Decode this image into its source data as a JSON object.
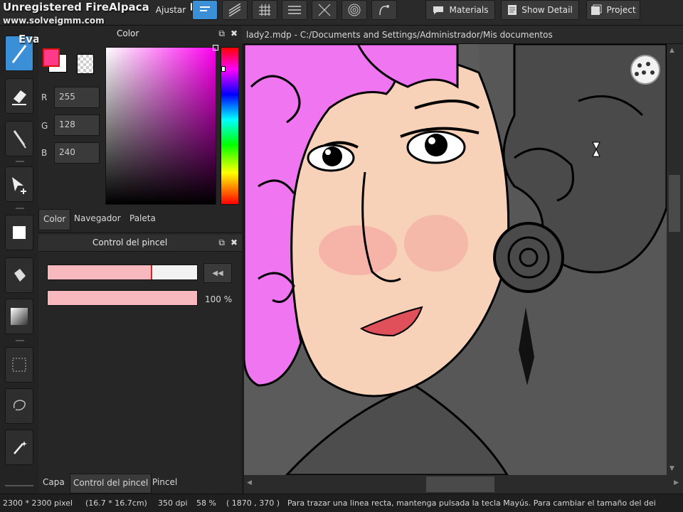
{
  "watermark": {
    "line1": "Unregistered FireAlpaca ClipArt",
    "line2": "www.solveigmm.com",
    "line3": "Evaluation Expired"
  },
  "toolbar": {
    "ajustar": "Ajustar",
    "materials": "Materials",
    "show_detail": "Show Detail",
    "project": "Project"
  },
  "color_panel": {
    "title": "Color",
    "fg_color": "#ff3a8a",
    "bg_color": "#ffffff",
    "r_label": "R",
    "r_value": "255",
    "g_label": "G",
    "g_value": "128",
    "b_label": "B",
    "b_value": "240",
    "tabs": [
      "Color",
      "Navegador",
      "Paleta"
    ]
  },
  "brush_panel": {
    "title": "Control del pincel",
    "size_fraction": 0.7,
    "opacity_value": "100 %"
  },
  "left_tabs": [
    "Capa",
    "Control del pincel",
    "Pincel"
  ],
  "document": {
    "tab_title": "lady2.mdp - C:/Documents and Settings/Administrador/Mis documentos"
  },
  "status": {
    "size": "2300 * 2300 pixel",
    "cm": "(16.7 * 16.7cm)",
    "dpi": "350 dpi",
    "zoom": "58 %",
    "coords": "( 1870 , 370 )",
    "hint": "Para trazar una linea recta, mantenga pulsada la tecla Mayús. Para cambiar el tamaño del dei"
  }
}
